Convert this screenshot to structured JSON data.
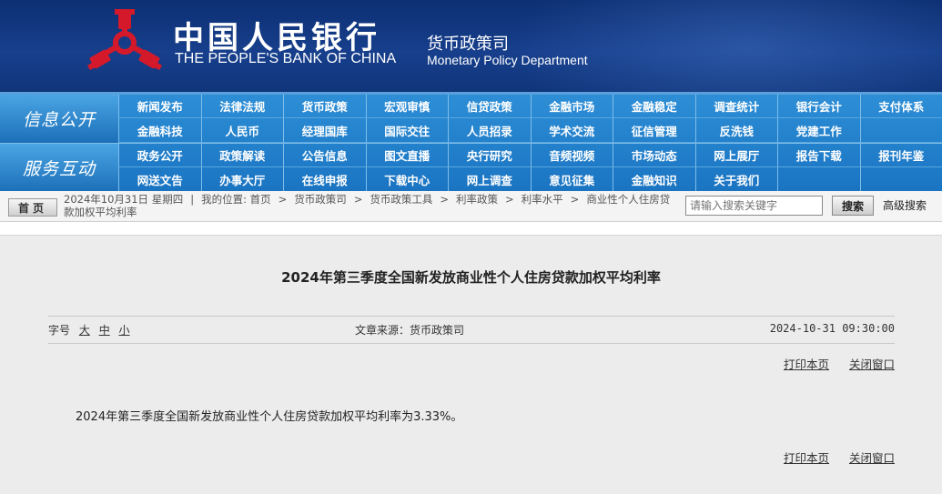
{
  "header": {
    "bank_name_cn": "中国人民银行",
    "bank_name_en": "THE PEOPLE'S BANK OF CHINA",
    "dept_cn": "货币政策司",
    "dept_en": "Monetary Policy Department",
    "logo_color": "#d4192a"
  },
  "nav": {
    "group1_title": "信息公开",
    "group1_items": [
      "新闻发布",
      "法律法规",
      "货币政策",
      "宏观审慎",
      "信贷政策",
      "金融市场",
      "金融稳定",
      "调查统计",
      "银行会计",
      "支付体系",
      "金融科技",
      "人民币",
      "经理国库",
      "国际交往",
      "人员招录",
      "学术交流",
      "征信管理",
      "反洗钱",
      "党建工作",
      ""
    ],
    "group2_title": "服务互动",
    "group2_items": [
      "政务公开",
      "政策解读",
      "公告信息",
      "图文直播",
      "央行研究",
      "音频视频",
      "市场动态",
      "网上展厅",
      "报告下载",
      "报刊年鉴",
      "网送文告",
      "办事大厅",
      "在线申报",
      "下载中心",
      "网上调查",
      "意见征集",
      "金融知识",
      "关于我们",
      "",
      ""
    ]
  },
  "breadcrumb": {
    "home_label": "首页",
    "date": "2024年10月31日 星期四",
    "location_label": "我的位置:",
    "path": [
      "首页",
      "货币政策司",
      "货币政策工具",
      "利率政策",
      "利率水平",
      "商业性个人住房贷款加权平均利率"
    ]
  },
  "search": {
    "placeholder": "请输入搜索关键字",
    "button_label": "搜索",
    "advanced_label": "高级搜索"
  },
  "article": {
    "title": "2024年第三季度全国新发放商业性个人住房贷款加权平均利率",
    "font_size_label": "字号",
    "font_sizes": [
      "大",
      "中",
      "小"
    ],
    "source": "文章来源：货币政策司",
    "datetime": "2024-10-31  09:30:00",
    "print_label": "打印本页",
    "close_label": "关闭窗口",
    "body": "2024年第三季度全国新发放商业性个人住房贷款加权平均利率为3.33%。"
  }
}
